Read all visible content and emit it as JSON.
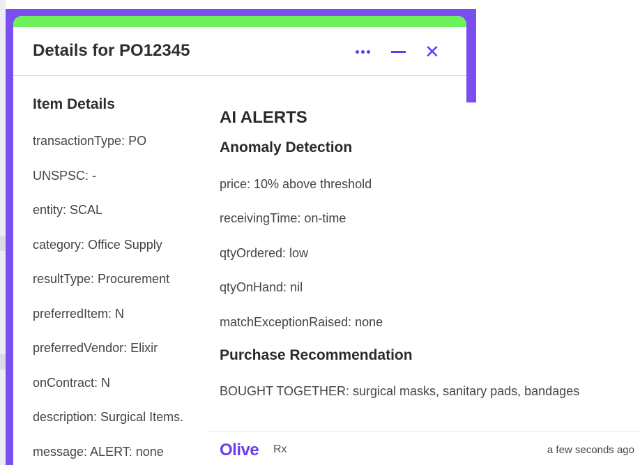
{
  "window": {
    "title": "Details for PO12345",
    "more_icon": "more-horizontal-icon",
    "minimize_icon": "minimize-icon",
    "close_icon": "close-icon",
    "close_glyph": "✕"
  },
  "item_details": {
    "heading": "Item Details",
    "rows": [
      "transactionType: PO",
      "UNSPSC: -",
      "entity: SCAL",
      "category: Office Supply",
      "resultType: Procurement",
      "preferredItem: N",
      "preferredVendor: Elixir",
      "onContract: N",
      "description: Surgical Items.",
      "message: ALERT: none"
    ]
  },
  "ai_alerts": {
    "title": "AI ALERTS",
    "anomaly_heading": "Anomaly Detection",
    "anomalies": [
      "price: 10% above threshold",
      "receivingTime: on-time",
      "qtyOrdered: low",
      "qtyOnHand: nil",
      "matchExceptionRaised: none"
    ],
    "recommendation_heading": "Purchase Recommendation",
    "recommendation": "BOUGHT TOGETHER: surgical masks, sanitary pads, bandages"
  },
  "footer": {
    "brand": "Olive",
    "product": "Rx",
    "timestamp": "a few seconds ago"
  },
  "colors": {
    "accent": "#5c3ff2",
    "frame": "#7b4ef0",
    "top_bar": "#6ef25c",
    "brand": "#6a3ff0"
  }
}
